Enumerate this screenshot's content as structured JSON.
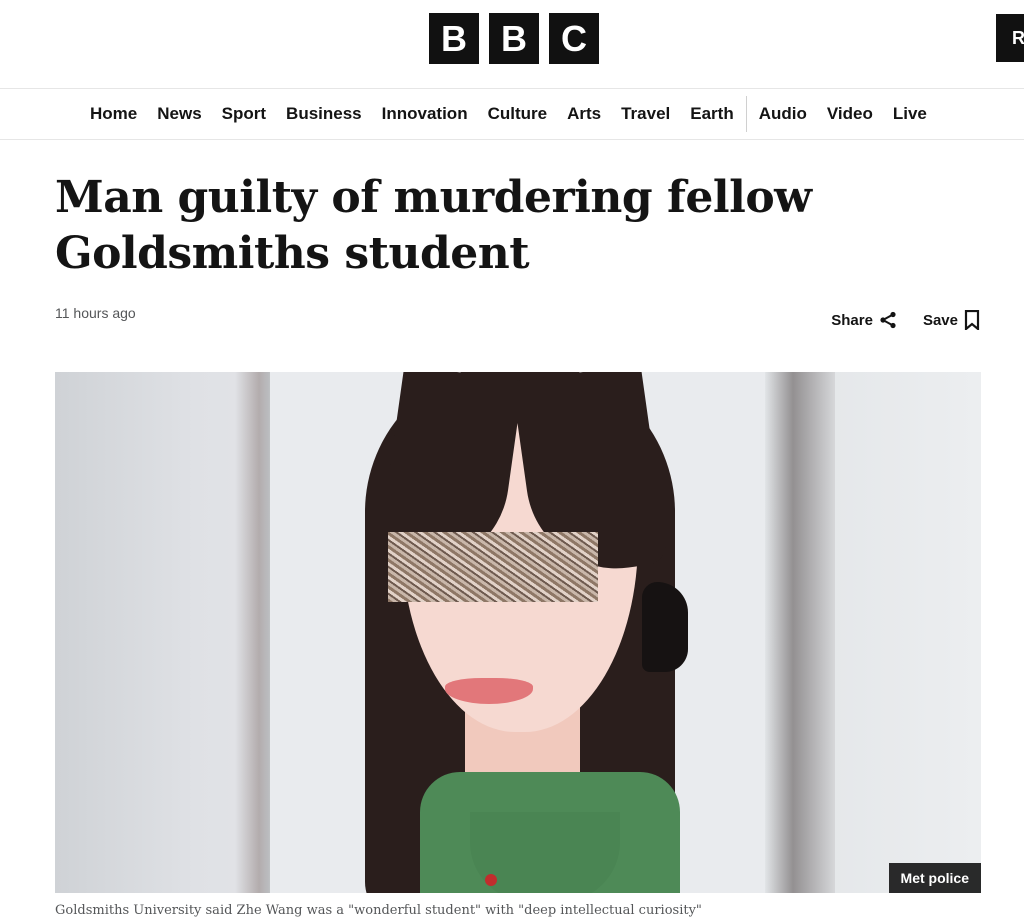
{
  "header": {
    "logo_letters": [
      "B",
      "B",
      "C"
    ],
    "edge_button_label": "R"
  },
  "nav": {
    "items": [
      "Home",
      "News",
      "Sport",
      "Business",
      "Innovation",
      "Culture",
      "Arts",
      "Travel",
      "Earth",
      "Audio",
      "Video",
      "Live"
    ]
  },
  "article": {
    "headline": "Man guilty of murdering fellow Goldsmiths student",
    "timestamp": "11 hours ago",
    "share_label": "Share",
    "save_label": "Save",
    "image_credit": "Met police",
    "caption": "Goldsmiths University said Zhe Wang was a \"wonderful student\" with \"deep intellectual curiosity\""
  },
  "icons": {
    "share": "share-icon",
    "save": "bookmark-icon"
  }
}
